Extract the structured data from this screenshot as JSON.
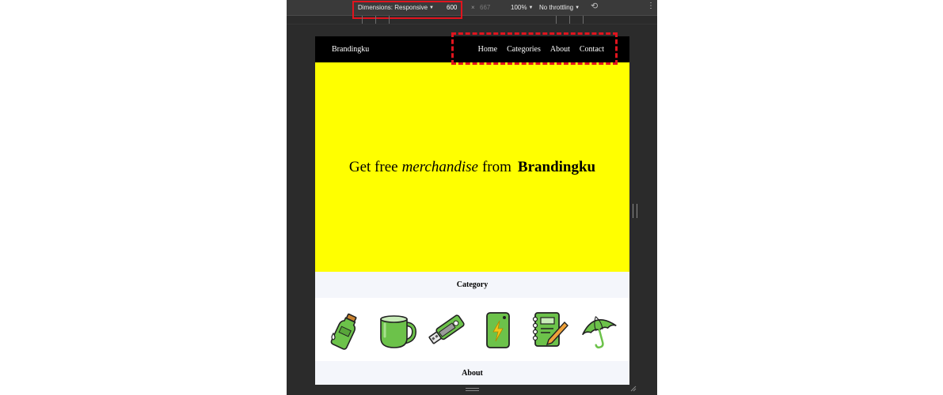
{
  "devtools": {
    "dimensions_label": "Dimensions: Responsive",
    "width": "600",
    "times": "×",
    "height": "667",
    "zoom": "100%",
    "throttling": "No throttling",
    "more": "⋮",
    "rotate": "⟲"
  },
  "page": {
    "brand": "Brandingku",
    "nav": [
      "Home",
      "Categories",
      "About",
      "Contact"
    ],
    "hero": {
      "prefix": "Get free",
      "emphasis": "merchandise",
      "middle": "from",
      "brand": "Brandingku"
    },
    "category_title": "Category",
    "categories": [
      "bottle-icon",
      "mug-icon",
      "usb-drive-icon",
      "power-bank-icon",
      "notebook-icon",
      "umbrella-icon"
    ],
    "about_title": "About"
  },
  "colors": {
    "hero_bg": "#ffff00",
    "nav_bg": "#000000",
    "annotation": "#e0141e",
    "icon_green": "#6cc24a"
  }
}
